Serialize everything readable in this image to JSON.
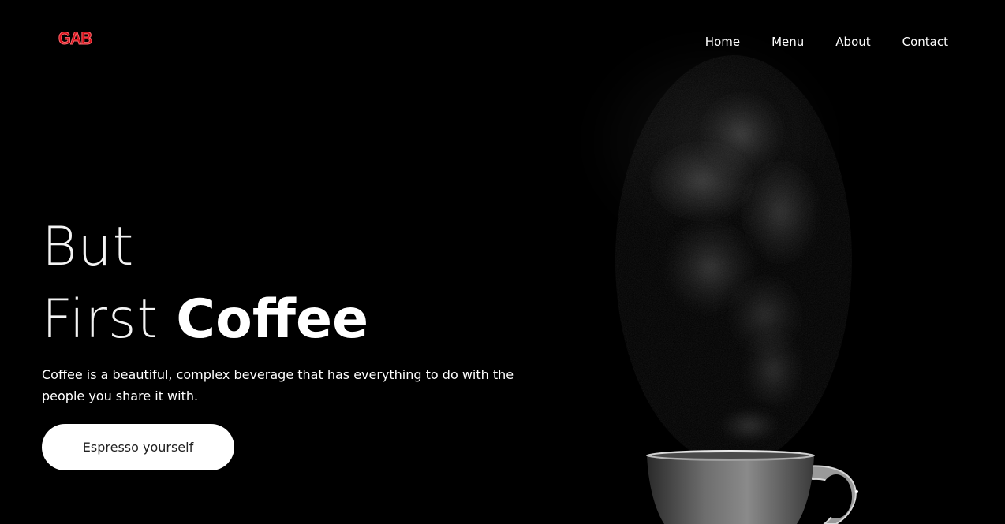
{
  "brand": {
    "logo_text": "GAB",
    "logo_color": "#d4101a"
  },
  "nav": {
    "items": [
      {
        "label": "Home"
      },
      {
        "label": "Menu"
      },
      {
        "label": "About"
      },
      {
        "label": "Contact"
      }
    ]
  },
  "hero": {
    "line1": "But",
    "line2_light": "First",
    "line2_bold": "Coffee",
    "subtitle": "Coffee is a beautiful, complex beverage that has everything to do with the people you share it with.",
    "cta_label": "Espresso yourself"
  },
  "colors": {
    "background": "#000000",
    "text": "#ffffff",
    "button_bg": "#ffffff",
    "button_text": "#222222"
  }
}
